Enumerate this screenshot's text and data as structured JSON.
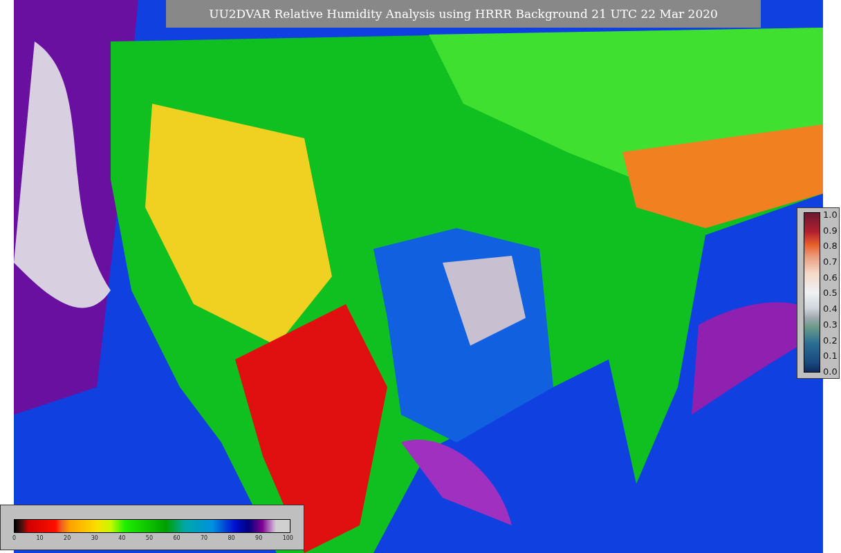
{
  "title": "UU2DVAR Relative Humidity Analysis using HRRR Background 21 UTC 22 Mar 2020",
  "observation_colorbar": {
    "ticks": [
      "1.0",
      "0.9",
      "0.8",
      "0.7",
      "0.6",
      "0.5",
      "0.4",
      "0.3",
      "0.2",
      "0.1",
      "0.0"
    ]
  },
  "humidity_colorbar": {
    "ticks": [
      "0",
      "10",
      "20",
      "30",
      "40",
      "50",
      "60",
      "70",
      "80",
      "90",
      "100"
    ]
  }
}
